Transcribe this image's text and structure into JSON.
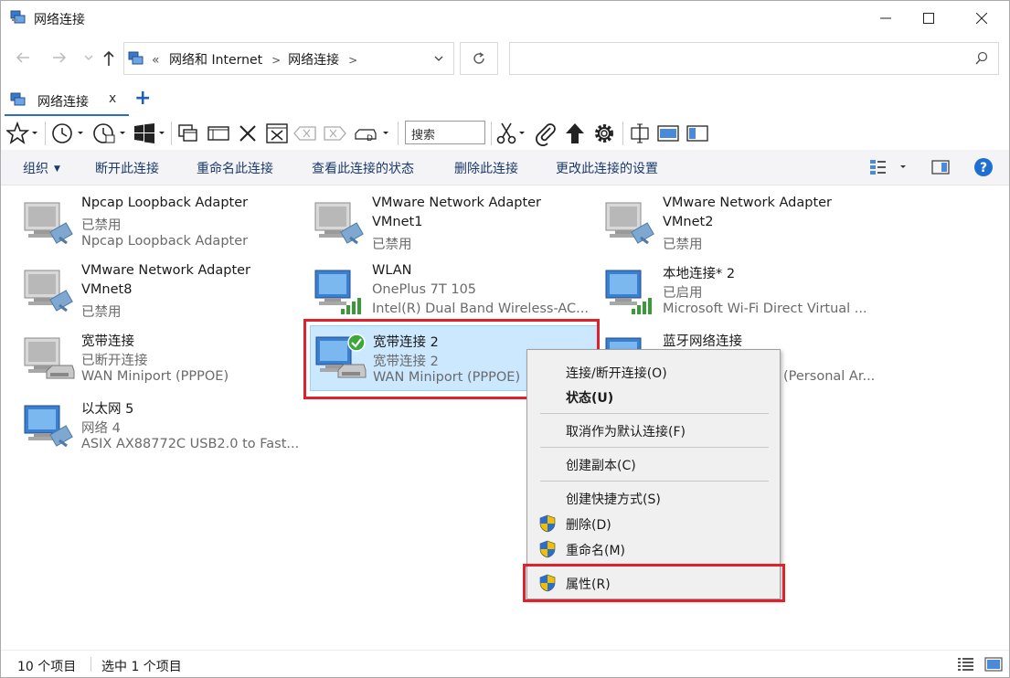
{
  "window": {
    "title": "网络连接",
    "icon": "network-connections-icon"
  },
  "address": {
    "crumb_prefix": "«",
    "crumbs": [
      "网络和 Internet",
      "网络连接"
    ],
    "search_placeholder": ""
  },
  "tab": {
    "label": "网络连接",
    "close": "x",
    "add": "+"
  },
  "toolbar": {
    "search_label": "搜索"
  },
  "commands": {
    "organize": "组织",
    "disconnect": "断开此连接",
    "rename": "重命名此连接",
    "view_status": "查看此连接的状态",
    "delete": "删除此连接",
    "change_settings": "更改此连接的设置"
  },
  "items": [
    {
      "name": "Npcap Loopback Adapter",
      "status": "已禁用",
      "device": "Npcap Loopback Adapter",
      "kind": "ethernet-disabled"
    },
    {
      "name": "VMware Network Adapter VMnet1",
      "status": "",
      "device": "已禁用",
      "kind": "ethernet-disabled",
      "name1": "VMware Network Adapter",
      "name2": "VMnet1"
    },
    {
      "name": "VMware Network Adapter VMnet2",
      "status": "",
      "device": "已禁用",
      "kind": "ethernet-disabled",
      "name1": "VMware Network Adapter",
      "name2": "VMnet2"
    },
    {
      "name": "VMware Network Adapter VMnet8",
      "status": "",
      "device": "已禁用",
      "kind": "ethernet-disabled",
      "name1": "VMware Network Adapter",
      "name2": "VMnet8"
    },
    {
      "name": "WLAN",
      "status": "OnePlus 7T 105",
      "device": "Intel(R) Dual Band Wireless-AC...",
      "kind": "wifi"
    },
    {
      "name": "本地连接* 2",
      "status": "已启用",
      "device": "Microsoft Wi-Fi Direct Virtual ...",
      "kind": "wifi"
    },
    {
      "name": "宽带连接",
      "status": "已断开连接",
      "device": "WAN Miniport (PPPOE)",
      "kind": "broadband-off"
    },
    {
      "name": "宽带连接 2",
      "status": "宽带连接 2",
      "device": "WAN Miniport (PPPOE)",
      "kind": "broadband-on"
    },
    {
      "name": "蓝牙网络连接",
      "status": "",
      "device": "(Personal Ar...",
      "kind": "bluetooth"
    },
    {
      "name": "以太网 5",
      "status": "网络 4",
      "device": "ASIX AX88772C USB2.0 to Fast...",
      "kind": "ethernet"
    }
  ],
  "context_menu": {
    "items": [
      {
        "label": "连接/断开连接(O)",
        "shield": false,
        "bold": false
      },
      {
        "label": "状态(U)",
        "shield": false,
        "bold": true
      },
      {
        "label": "取消作为默认连接(F)",
        "shield": false,
        "bold": false
      },
      {
        "label": "创建副本(C)",
        "shield": false,
        "bold": false
      },
      {
        "label": "创建快捷方式(S)",
        "shield": false,
        "bold": false
      },
      {
        "label": "删除(D)",
        "shield": true,
        "bold": false
      },
      {
        "label": "重命名(M)",
        "shield": true,
        "bold": false
      },
      {
        "label": "属性(R)",
        "shield": true,
        "bold": false
      }
    ]
  },
  "status": {
    "count": "10 个项目",
    "selected": "选中 1 个项目"
  },
  "colors": {
    "accent": "#1f5fbf",
    "selection": "#cce8ff",
    "highlight": "#e0202a",
    "help": "#1f6fd0"
  }
}
